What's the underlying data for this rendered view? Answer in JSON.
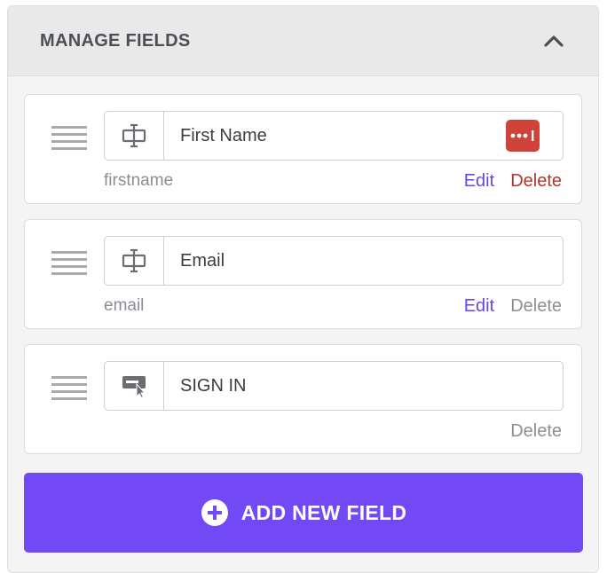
{
  "panel": {
    "title": "MANAGE FIELDS"
  },
  "fields": [
    {
      "label": "First Name",
      "key": "firstname",
      "type_icon": "text-field-icon",
      "edit_label": "Edit",
      "delete_label": "Delete",
      "has_password_badge": true
    },
    {
      "label": "Email",
      "key": "email",
      "type_icon": "text-field-icon",
      "edit_label": "Edit",
      "delete_label": "Delete",
      "has_password_badge": false
    },
    {
      "label": "SIGN IN",
      "key": "",
      "type_icon": "button-cursor-icon",
      "edit_label": "",
      "delete_label": "Delete",
      "has_password_badge": false
    }
  ],
  "add_button": {
    "label": "ADD NEW FIELD"
  },
  "colors": {
    "accent": "#7249f5",
    "edit": "#6a45e0",
    "delete_active": "#b0382f",
    "badge": "#d0433a"
  }
}
